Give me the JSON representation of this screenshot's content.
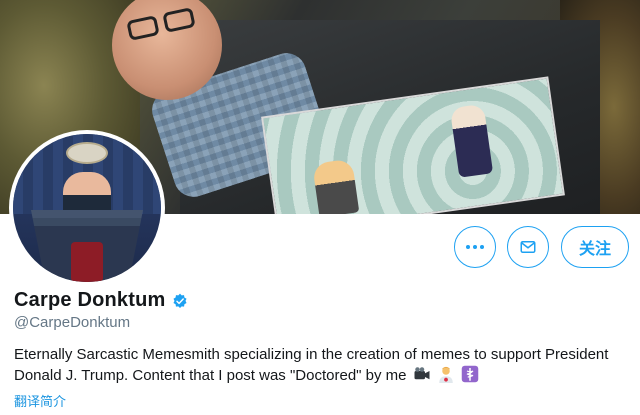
{
  "profile": {
    "name": "Carpe Donktum",
    "handle": "@CarpeDonktum",
    "bio": "Eternally Sarcastic Memesmith specializing in the creation of memes to support President Donald J. Trump. Content that I post was \"Doctored\" by me",
    "translate_label": "翻译简介",
    "verified": true
  },
  "actions": {
    "more_icon": "more-dots-icon",
    "message_icon": "envelope-icon",
    "follow_label": "关注"
  },
  "emojis": [
    "video-camera-icon",
    "man-health-worker-icon",
    "medical-symbol-icon"
  ],
  "colors": {
    "accent": "#1da1f2",
    "text": "#14171a",
    "secondary": "#657786"
  }
}
